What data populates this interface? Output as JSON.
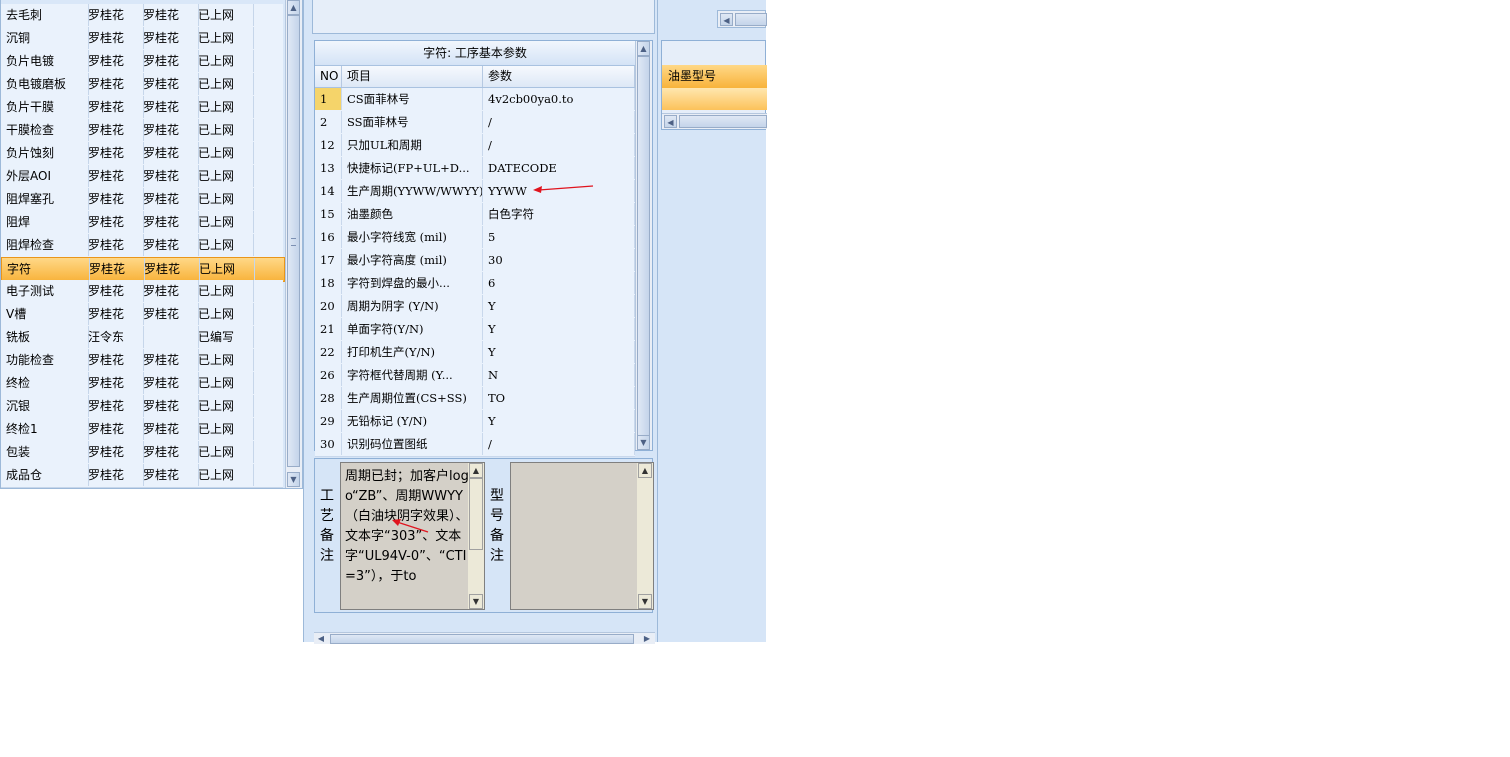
{
  "process_list": {
    "rows": [
      {
        "name": "去毛刺",
        "a": "罗桂花",
        "b": "罗桂花",
        "status": "已上网"
      },
      {
        "name": "沉铜",
        "a": "罗桂花",
        "b": "罗桂花",
        "status": "已上网"
      },
      {
        "name": "负片电镀",
        "a": "罗桂花",
        "b": "罗桂花",
        "status": "已上网"
      },
      {
        "name": "负电镀磨板",
        "a": "罗桂花",
        "b": "罗桂花",
        "status": "已上网"
      },
      {
        "name": "负片干膜",
        "a": "罗桂花",
        "b": "罗桂花",
        "status": "已上网"
      },
      {
        "name": "干膜检查",
        "a": "罗桂花",
        "b": "罗桂花",
        "status": "已上网"
      },
      {
        "name": "负片蚀刻",
        "a": "罗桂花",
        "b": "罗桂花",
        "status": "已上网"
      },
      {
        "name": "外层AOI",
        "a": "罗桂花",
        "b": "罗桂花",
        "status": "已上网"
      },
      {
        "name": "阻焊塞孔",
        "a": "罗桂花",
        "b": "罗桂花",
        "status": "已上网"
      },
      {
        "name": "阻焊",
        "a": "罗桂花",
        "b": "罗桂花",
        "status": "已上网"
      },
      {
        "name": "阻焊检查",
        "a": "罗桂花",
        "b": "罗桂花",
        "status": "已上网"
      },
      {
        "name": "字符",
        "a": "罗桂花",
        "b": "罗桂花",
        "status": "已上网",
        "selected": true
      },
      {
        "name": "电子测试",
        "a": "罗桂花",
        "b": "罗桂花",
        "status": "已上网"
      },
      {
        "name": "V槽",
        "a": "罗桂花",
        "b": "罗桂花",
        "status": "已上网"
      },
      {
        "name": "铣板",
        "a": "汪令东",
        "b": "",
        "status": "已编写"
      },
      {
        "name": "功能检查",
        "a": "罗桂花",
        "b": "罗桂花",
        "status": "已上网"
      },
      {
        "name": "终检",
        "a": "罗桂花",
        "b": "罗桂花",
        "status": "已上网"
      },
      {
        "name": "沉银",
        "a": "罗桂花",
        "b": "罗桂花",
        "status": "已上网"
      },
      {
        "name": "终检1",
        "a": "罗桂花",
        "b": "罗桂花",
        "status": "已上网"
      },
      {
        "name": "包装",
        "a": "罗桂花",
        "b": "罗桂花",
        "status": "已上网"
      },
      {
        "name": "成品仓",
        "a": "罗桂花",
        "b": "罗桂花",
        "status": "已上网"
      }
    ]
  },
  "params": {
    "title": "字符: 工序基本参数",
    "columns": {
      "no": "NO",
      "item": "项目",
      "value": "参数"
    },
    "rows": [
      {
        "no": "1",
        "item": "CS面菲林号",
        "value": "4v2cb00ya0.to",
        "highlight": true
      },
      {
        "no": "2",
        "item": "SS面菲林号",
        "value": "/"
      },
      {
        "no": "12",
        "item": "只加UL和周期",
        "value": "/"
      },
      {
        "no": "13",
        "item": "快捷标记(FP+UL+D...",
        "value": "DATECODE"
      },
      {
        "no": "14",
        "item": "生产周期(YYWW/WWYY)",
        "value": "YYWW"
      },
      {
        "no": "15",
        "item": "油墨颜色",
        "value": "白色字符"
      },
      {
        "no": "16",
        "item": "最小字符线宽 (mil)",
        "value": "5"
      },
      {
        "no": "17",
        "item": "最小字符高度 (mil)",
        "value": "30"
      },
      {
        "no": "18",
        "item": "字符到焊盘的最小...",
        "value": "6"
      },
      {
        "no": "20",
        "item": "周期为阴字 (Y/N)",
        "value": "Y"
      },
      {
        "no": "21",
        "item": "单面字符(Y/N)",
        "value": "Y"
      },
      {
        "no": "22",
        "item": "打印机生产(Y/N)",
        "value": "Y"
      },
      {
        "no": "26",
        "item": "字符框代替周期 (Y...",
        "value": "N"
      },
      {
        "no": "28",
        "item": "生产周期位置(CS+SS)",
        "value": "TO"
      },
      {
        "no": "29",
        "item": "无铅标记 (Y/N)",
        "value": "Y"
      },
      {
        "no": "30",
        "item": "识别码位置图纸",
        "value": "/"
      }
    ]
  },
  "notes": {
    "process_label": [
      "工",
      "艺",
      "备",
      "注"
    ],
    "model_label": [
      "型",
      "号",
      "备",
      "注"
    ],
    "process_text": "周期已封；加客户logo“ZB”、周期WWYY（白油块阴字效果）、文本字“303”、文本字“UL94V-0”、“CTI=3”），于to",
    "model_text": ""
  },
  "right_panel": {
    "ink_header": "油墨型号"
  },
  "colors": {
    "selected_row": "#f8b33b",
    "annotation_arrow": "#e0141e",
    "panel_bg": "#d6e5f7"
  }
}
